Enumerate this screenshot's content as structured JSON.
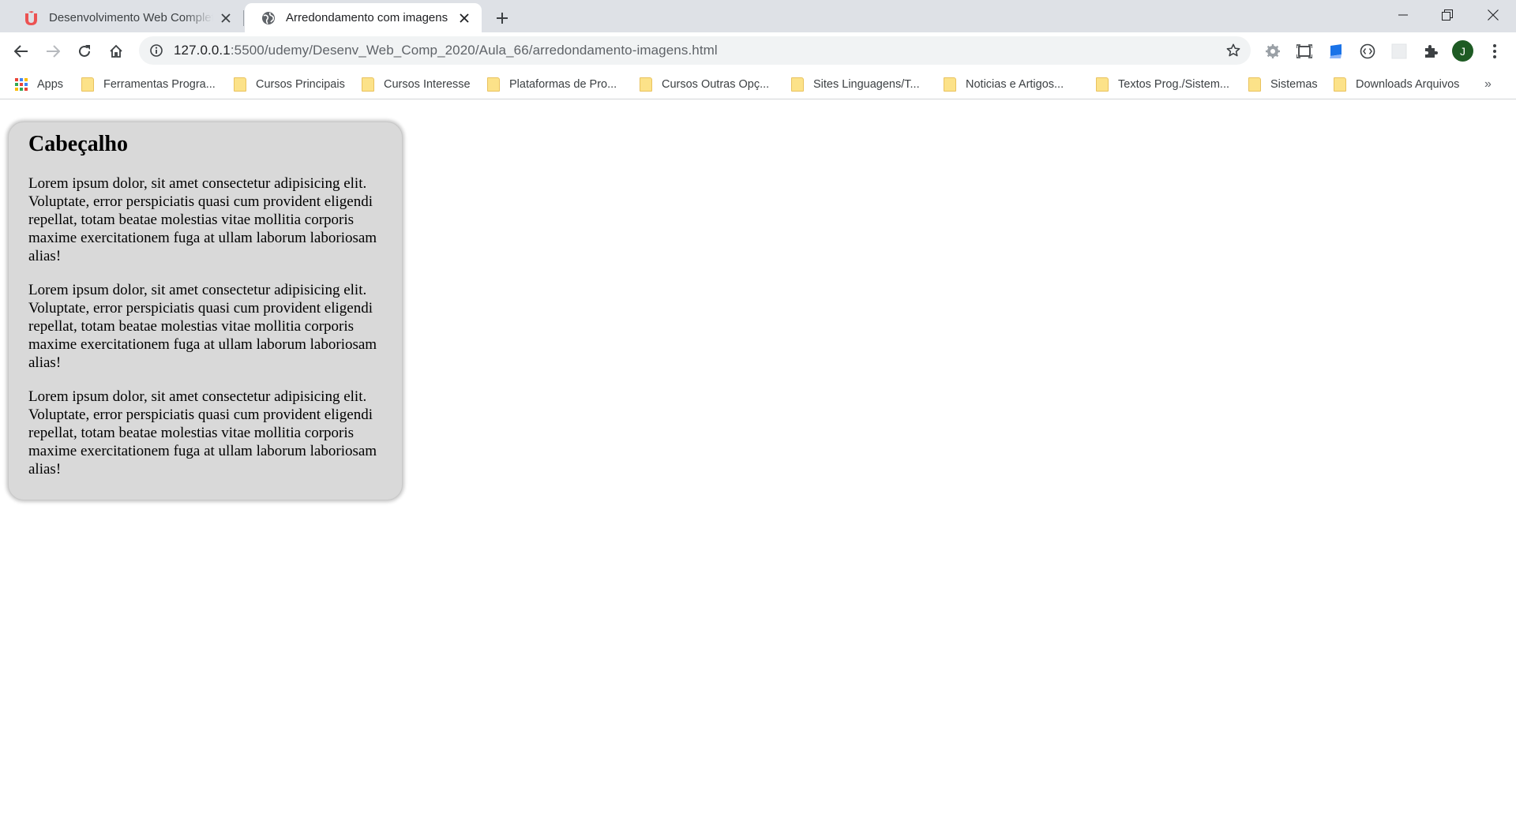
{
  "browser": {
    "tabs": [
      {
        "title": "Desenvolvimento Web Completo",
        "favicon": "udemy-icon",
        "active": false
      },
      {
        "title": "Arredondamento com imagens",
        "favicon": "globe-icon",
        "active": true
      }
    ],
    "address_bar": {
      "url_host": "127.0.0.1",
      "url_path": ":5500/udemy/Desenv_Web_Comp_2020/Aula_66/arredondamento-imagens.html"
    },
    "profile_initial": "J",
    "bookmarks": [
      {
        "label": "Apps",
        "icon": "apps-grid-icon"
      },
      {
        "label": "Ferramentas Progra...",
        "icon": "folder-icon"
      },
      {
        "label": "Cursos Principais",
        "icon": "folder-icon"
      },
      {
        "label": "Cursos Interesse",
        "icon": "folder-icon"
      },
      {
        "label": "Plataformas de Pro...",
        "icon": "folder-icon"
      },
      {
        "label": "Cursos Outras Opç...",
        "icon": "folder-icon"
      },
      {
        "label": "Sites Linguagens/T...",
        "icon": "folder-icon"
      },
      {
        "label": "Noticias e Artigos...",
        "icon": "folder-icon"
      },
      {
        "label": "Textos Prog./Sistem...",
        "icon": "folder-icon"
      },
      {
        "label": "Sistemas",
        "icon": "folder-icon"
      },
      {
        "label": "Downloads Arquivos",
        "icon": "folder-icon"
      }
    ],
    "bookmarks_overflow": "»"
  },
  "page": {
    "heading": "Cabeçalho",
    "paragraphs": [
      "Lorem ipsum dolor, sit amet consectetur adipisicing elit. Voluptate, error perspiciatis quasi cum provident eligendi repellat, totam beatae molestias vitae mollitia corporis maxime exercitationem fuga at ullam laborum laboriosam alias!",
      "Lorem ipsum dolor, sit amet consectetur adipisicing elit. Voluptate, error perspiciatis quasi cum provident eligendi repellat, totam beatae molestias vitae mollitia corporis maxime exercitationem fuga at ullam laborum laboriosam alias!",
      "Lorem ipsum dolor, sit amet consectetur adipisicing elit. Voluptate, error perspiciatis quasi cum provident eligendi repellat, totam beatae molestias vitae mollitia corporis maxime exercitationem fuga at ullam laborum laboriosam alias!"
    ]
  },
  "colors": {
    "tabstrip_bg": "#dee1e6",
    "omnibox_bg": "#f1f3f4",
    "card_bg": "#d9d9d9",
    "folder_yellow": "#fce289",
    "udemy_red": "#ec5252",
    "avatar_green": "#1e5b24"
  }
}
